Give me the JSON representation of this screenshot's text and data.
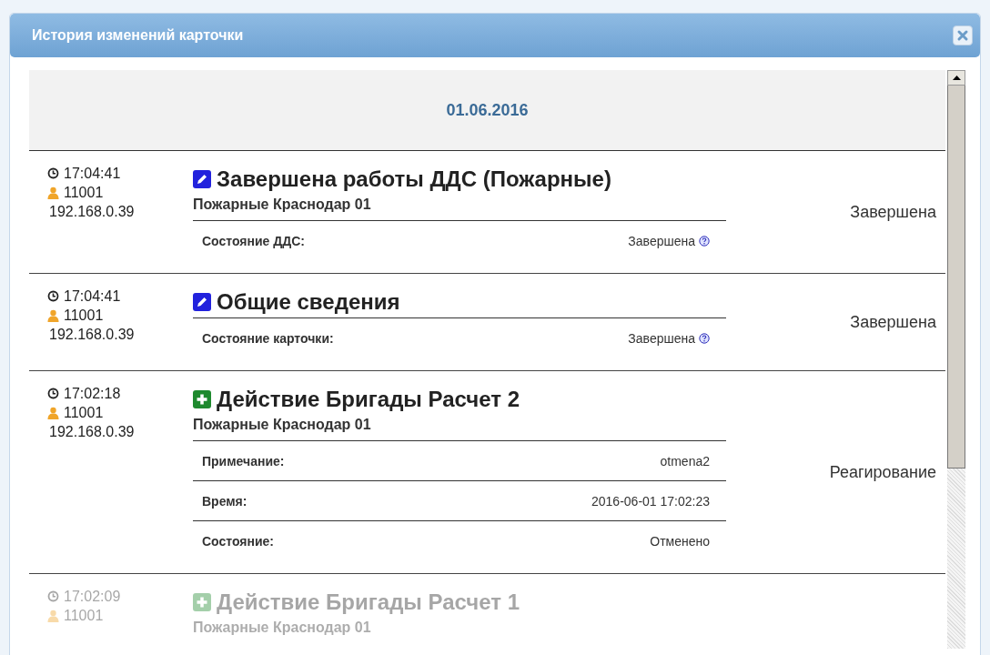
{
  "window": {
    "title": "История изменений карточки"
  },
  "date": "01.06.2016",
  "entries": [
    {
      "time": "17:04:41",
      "user": "11001",
      "ip": "192.168.0.39",
      "kind": "edit",
      "title": "Завершена работы ДДС (Пожарные)",
      "subtitle": "Пожарные Краснодар 01",
      "status": "Завершена",
      "faded": false,
      "fields": [
        {
          "label": "Состояние ДДС:",
          "value": "Завершена",
          "help": true
        }
      ]
    },
    {
      "time": "17:04:41",
      "user": "11001",
      "ip": "192.168.0.39",
      "kind": "edit",
      "title": "Общие сведения",
      "status": "Завершена",
      "faded": false,
      "fields": [
        {
          "label": "Состояние карточки:",
          "value": "Завершена",
          "help": true
        }
      ]
    },
    {
      "time": "17:02:18",
      "user": "11001",
      "ip": "192.168.0.39",
      "kind": "add",
      "title": "Действие Бригады Расчет 2",
      "subtitle": "Пожарные Краснодар 01",
      "status": "Реагирование",
      "faded": false,
      "fields": [
        {
          "label": "Примечание:",
          "value": "otmena2",
          "help": false
        },
        {
          "label": "Время:",
          "value": "2016-06-01 17:02:23",
          "help": false
        },
        {
          "label": "Состояние:",
          "value": "Отменено",
          "help": false
        }
      ]
    },
    {
      "time": "17:02:09",
      "user": "11001",
      "kind": "add",
      "title": "Действие Бригады Расчет 1",
      "subtitle": "Пожарные Краснодар 01",
      "faded": true
    }
  ]
}
